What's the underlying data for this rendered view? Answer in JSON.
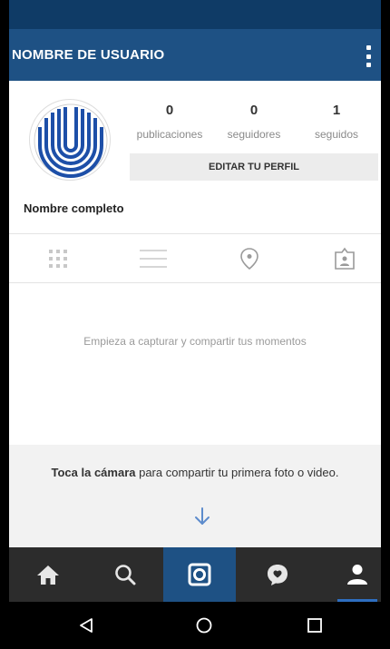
{
  "app_bar": {
    "title": "NOMBRE DE USUARIO"
  },
  "profile": {
    "stats": [
      {
        "value": "0",
        "label": "publicaciones"
      },
      {
        "value": "0",
        "label": "seguidores"
      },
      {
        "value": "1",
        "label": "seguidos"
      }
    ],
    "edit_button": "EDITAR TU PERFIL",
    "full_name": "Nombre completo"
  },
  "tabs": [
    "grid-icon",
    "list-icon",
    "location-pin-icon",
    "tagged-person-icon"
  ],
  "empty_message": "Empieza a capturar y compartir tus momentos",
  "hint": {
    "bold": "Toca la cámara",
    "rest": " para compartir tu primera foto o video."
  },
  "bottom_nav": [
    "home-icon",
    "search-icon",
    "camera-icon",
    "activity-icon",
    "profile-icon"
  ],
  "colors": {
    "accent": "#1e5184",
    "status_bar": "#0f3b66",
    "nav_bg": "#2c2c2c"
  }
}
